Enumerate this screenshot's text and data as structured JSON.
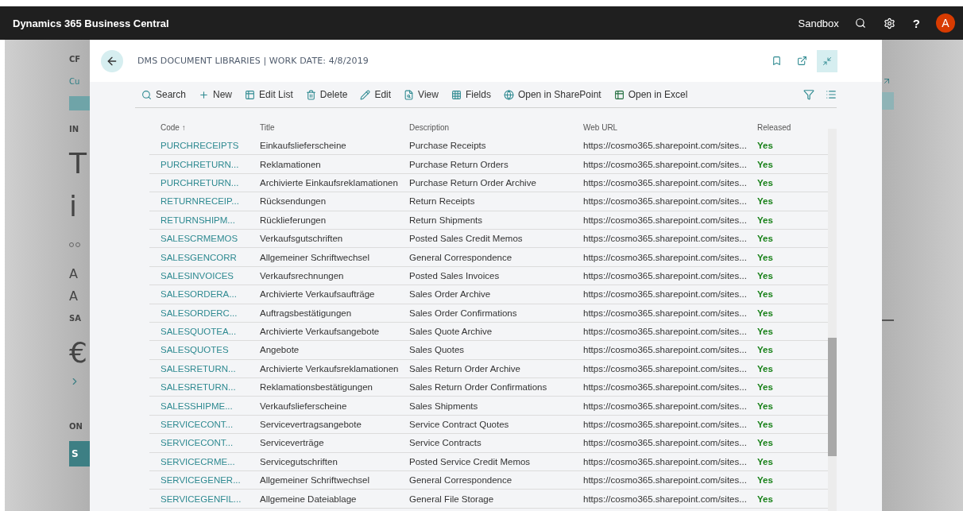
{
  "app_bar": {
    "title": "Dynamics 365 Business Central",
    "environment": "Sandbox",
    "avatar": "A",
    "help": "?"
  },
  "background_page": {
    "fragments": [
      {
        "kind": "title",
        "text": "CF"
      },
      {
        "kind": "link",
        "text": "Cu"
      },
      {
        "kind": "button"
      },
      {
        "kind": "label",
        "text": "IN"
      },
      {
        "kind": "huge",
        "text": "T"
      },
      {
        "kind": "huge",
        "text": "i"
      },
      {
        "kind": "dots"
      },
      {
        "kind": "heading",
        "text": "A"
      },
      {
        "kind": "heading",
        "text": "A"
      },
      {
        "kind": "label",
        "text": "SA"
      },
      {
        "kind": "huge",
        "text": "€"
      },
      {
        "kind": "chevron"
      },
      {
        "kind": "label",
        "text": "ON"
      },
      {
        "kind": "tile",
        "text": "S"
      }
    ]
  },
  "dialog": {
    "title": "DMS DOCUMENT LIBRARIES | WORK DATE: 4/8/2019",
    "actions": [
      {
        "kind": "search",
        "label": "Search"
      },
      {
        "kind": "new",
        "label": "New"
      },
      {
        "kind": "editlist",
        "label": "Edit List"
      },
      {
        "kind": "delete",
        "label": "Delete"
      },
      {
        "kind": "edit",
        "label": "Edit"
      },
      {
        "kind": "view",
        "label": "View"
      },
      {
        "kind": "fields",
        "label": "Fields"
      },
      {
        "kind": "sharepoint",
        "label": "Open in SharePoint"
      },
      {
        "kind": "excel",
        "label": "Open in Excel"
      }
    ],
    "table": {
      "columns": [
        "Code ↑",
        "Title",
        "Description",
        "Web URL",
        "Released"
      ],
      "rows": [
        [
          "PURCHRECEIPTS",
          "Einkaufslieferscheine",
          "Purchase Receipts",
          "https://cosmo365.sharepoint.com/sites...",
          "Yes"
        ],
        [
          "PURCHRETURN...",
          "Reklamationen",
          "Purchase Return Orders",
          "https://cosmo365.sharepoint.com/sites...",
          "Yes"
        ],
        [
          "PURCHRETURN...",
          "Archivierte Einkaufsreklamationen",
          "Purchase Return Order Archive",
          "https://cosmo365.sharepoint.com/sites...",
          "Yes"
        ],
        [
          "RETURNRECEIP...",
          "Rücksendungen",
          "Return Receipts",
          "https://cosmo365.sharepoint.com/sites...",
          "Yes"
        ],
        [
          "RETURNSHIPM...",
          "Rücklieferungen",
          "Return Shipments",
          "https://cosmo365.sharepoint.com/sites...",
          "Yes"
        ],
        [
          "SALESCRMEMOS",
          "Verkaufsgutschriften",
          "Posted Sales Credit Memos",
          "https://cosmo365.sharepoint.com/sites...",
          "Yes"
        ],
        [
          "SALESGENCORR",
          "Allgemeiner Schriftwechsel",
          "General Correspondence",
          "https://cosmo365.sharepoint.com/sites...",
          "Yes"
        ],
        [
          "SALESINVOICES",
          "Verkaufsrechnungen",
          "Posted Sales Invoices",
          "https://cosmo365.sharepoint.com/sites...",
          "Yes"
        ],
        [
          "SALESORDERA...",
          "Archivierte Verkaufsaufträge",
          "Sales Order Archive",
          "https://cosmo365.sharepoint.com/sites...",
          "Yes"
        ],
        [
          "SALESORDERC...",
          "Auftragsbestätigungen",
          "Sales Order Confirmations",
          "https://cosmo365.sharepoint.com/sites...",
          "Yes"
        ],
        [
          "SALESQUOTEA...",
          "Archivierte Verkaufsangebote",
          "Sales Quote Archive",
          "https://cosmo365.sharepoint.com/sites...",
          "Yes"
        ],
        [
          "SALESQUOTES",
          "Angebote",
          "Sales Quotes",
          "https://cosmo365.sharepoint.com/sites...",
          "Yes"
        ],
        [
          "SALESRETURN...",
          "Archivierte Verkaufsreklamationen",
          "Sales Return Order Archive",
          "https://cosmo365.sharepoint.com/sites...",
          "Yes"
        ],
        [
          "SALESRETURN...",
          "Reklamationsbestätigungen",
          "Sales Return Order Confirmations",
          "https://cosmo365.sharepoint.com/sites...",
          "Yes"
        ],
        [
          "SALESSHIPME...",
          "Verkaufslieferscheine",
          "Sales Shipments",
          "https://cosmo365.sharepoint.com/sites...",
          "Yes"
        ],
        [
          "SERVICECONT...",
          "Servicevertragsangebote",
          "Service Contract Quotes",
          "https://cosmo365.sharepoint.com/sites...",
          "Yes"
        ],
        [
          "SERVICECONT...",
          "Serviceverträge",
          "Service Contracts",
          "https://cosmo365.sharepoint.com/sites...",
          "Yes"
        ],
        [
          "SERVICECRME...",
          "Servicegutschriften",
          "Posted Service Credit Memos",
          "https://cosmo365.sharepoint.com/sites...",
          "Yes"
        ],
        [
          "SERVICEGENER...",
          "Allgemeiner Schriftwechsel",
          "General Correspondence",
          "https://cosmo365.sharepoint.com/sites...",
          "Yes"
        ],
        [
          "SERVICEGENFIL...",
          "Allgemeine Dateiablage",
          "General File Storage",
          "https://cosmo365.sharepoint.com/sites...",
          "Yes"
        ]
      ]
    }
  }
}
